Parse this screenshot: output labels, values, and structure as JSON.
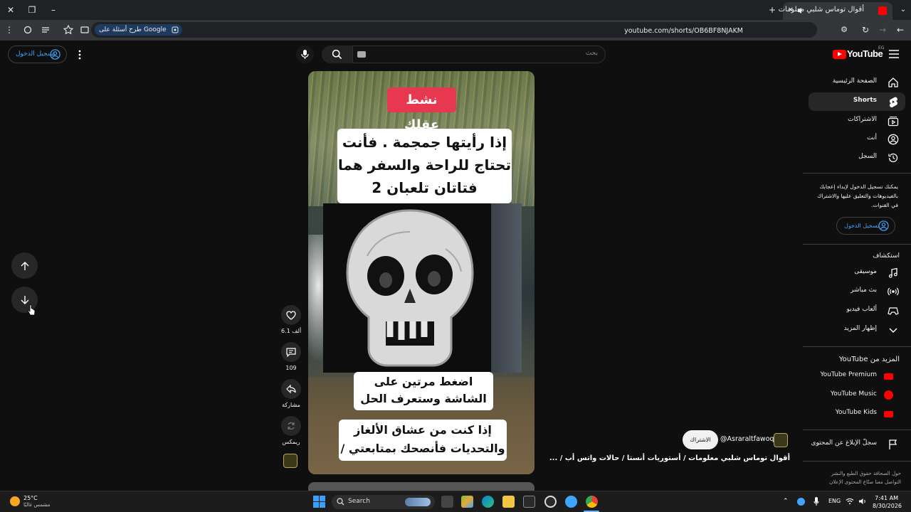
{
  "browser": {
    "tab_title": "أقوال توماس شلبي معلومات",
    "url": "youtube.com/shorts/OB6BF8NJAKM",
    "ask_google": "طرح أسئلة على Google"
  },
  "header": {
    "signin_label": "تسجيل الدخول",
    "search_placeholder": "بحث",
    "logo_text": "YouTube",
    "logo_region": "EG"
  },
  "video": {
    "label_top": "نشط عقلك",
    "caption_1": "إذا رأيتها جمجمة . فأنت تحتاج للراحة والسفر هما فتاتان تلعبان 2",
    "caption_2": "اضغط مرتين على الشاشة وستعرف الحل",
    "caption_3": "إذا كنت من عشاق الألغاز والتحديات فأنصحك بمتابعتي /"
  },
  "actions": {
    "like_count": "6.1 ألف",
    "comment_count": "109",
    "share_label": "مشاركة",
    "remix_label": "ريمكس"
  },
  "channel": {
    "handle": "@Asraraltfawoq",
    "subscribe_label": "الاشتراك",
    "short_title": "أقوال توماس شلبي معلومات / أستوريات أنستا / حالات واتس أب / ..."
  },
  "sidebar": {
    "main": [
      {
        "label": "الصفحة الرئيسية",
        "icon": "home-icon"
      },
      {
        "label": "Shorts",
        "icon": "shorts-icon"
      },
      {
        "label": "الاشتراكات",
        "icon": "subscriptions-icon"
      },
      {
        "label": "أنت",
        "icon": "you-icon"
      },
      {
        "label": "السجل",
        "icon": "history-icon"
      }
    ],
    "signin_prompt": "يمكنك تسجيل الدخول لإبداء إعجابك بالفيديوهات والتعليق عليها والاشتراك في القنوات.",
    "signin_label": "تسجيل الدخول",
    "explore_heading": "استكشاف",
    "explore": [
      {
        "label": "موسيقى",
        "icon": "music-icon"
      },
      {
        "label": "بث مباشر",
        "icon": "live-icon"
      },
      {
        "label": "ألعاب فيديو",
        "icon": "gaming-icon"
      },
      {
        "label": "إظهار المزيد",
        "icon": "chevron-down-icon"
      }
    ],
    "more_heading": "المزيد من YouTube",
    "more": [
      {
        "label": "YouTube Premium"
      },
      {
        "label": "YouTube Music"
      },
      {
        "label": "YouTube Kids"
      }
    ],
    "report_label": "سجلّ الإبلاغ عن المحتوى",
    "footer": "حول الصحافة حقوق الطبع والنشر التواصل معنا صنّاع المحتوى الإعلان"
  },
  "taskbar": {
    "temperature": "25°C",
    "condition": "مشمس غالبًا",
    "search_label": "Search",
    "lang": "ENG",
    "time": "7:41 AM",
    "date": "8/30/2026"
  }
}
